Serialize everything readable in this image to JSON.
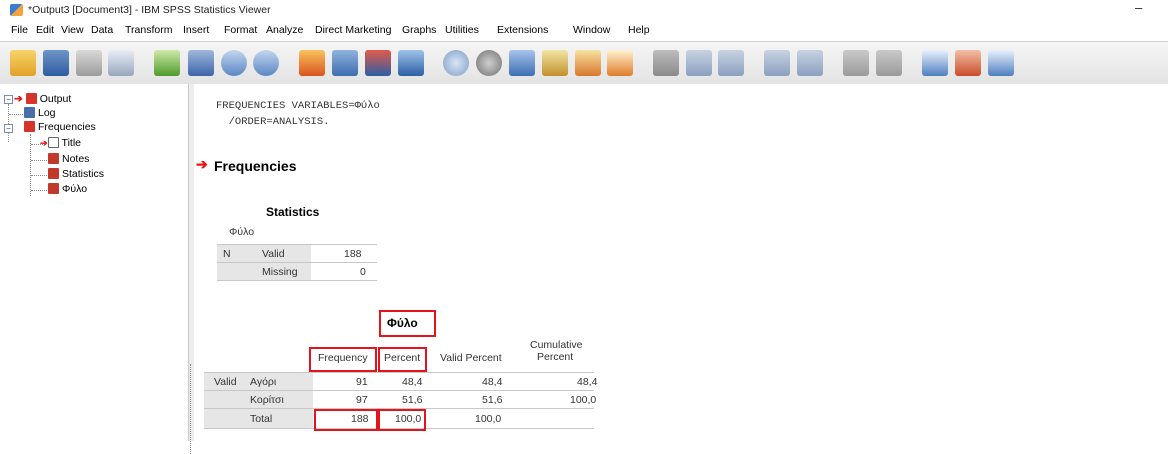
{
  "window": {
    "title": "*Output3 [Document3] - IBM SPSS Statistics Viewer",
    "minimize_glyph": "–"
  },
  "menu": [
    "File",
    "Edit",
    "View",
    "Data",
    "Transform",
    "Insert",
    "Format",
    "Analyze",
    "Direct Marketing",
    "Graphs",
    "Utilities",
    "Extensions",
    "Window",
    "Help"
  ],
  "toolbar_icons": [
    "open-icon",
    "save-icon",
    "print-icon",
    "print-preview-icon",
    "export-icon",
    "recall-dialog-icon",
    "undo-icon",
    "redo-icon",
    "goto-case-icon",
    "goto-variable-icon",
    "variables-icon",
    "insert-table-icon",
    "pie-icon",
    "circles-icon",
    "select-cases-icon",
    "value-labels-icon",
    "designate-window-icon",
    "script-icon",
    "show-all-icon",
    "promote-icon",
    "demote-icon",
    "expand-icon",
    "collapse-icon",
    "show-icon",
    "hide-icon",
    "insert-header-icon",
    "insert-title-icon",
    "insert-text-icon"
  ],
  "tree": {
    "root": "Output",
    "log": "Log",
    "frequencies": "Frequencies",
    "children": [
      "Title",
      "Notes",
      "Statistics",
      "Φύλο"
    ]
  },
  "syntax": {
    "line1": "FREQUENCIES VARIABLES=Φύλο",
    "line2": "  /ORDER=ANALYSIS."
  },
  "section_title": "Frequencies",
  "stats_table": {
    "title": "Statistics",
    "variable": "Φύλο",
    "n_label": "N",
    "rows": [
      {
        "label": "Valid",
        "value": "188"
      },
      {
        "label": "Missing",
        "value": "0"
      }
    ]
  },
  "freq_table": {
    "title": "Φύλο",
    "headers": {
      "frequency": "Frequency",
      "percent": "Percent",
      "valid_percent": "Valid Percent",
      "cumulative_1": "Cumulative",
      "cumulative_2": "Percent"
    },
    "group_label": "Valid",
    "rows": [
      {
        "label": "Αγόρι",
        "frequency": "91",
        "percent": "48,4",
        "valid_percent": "48,4",
        "cumulative": "48,4"
      },
      {
        "label": "Κορίτσι",
        "frequency": "97",
        "percent": "51,6",
        "valid_percent": "51,6",
        "cumulative": "100,0"
      },
      {
        "label": "Total",
        "frequency": "188",
        "percent": "100,0",
        "valid_percent": "100,0",
        "cumulative": ""
      }
    ]
  },
  "colors": {
    "highlight": "#e3141b",
    "arrow": "#e11111",
    "label_shade": "#e6e6e6"
  }
}
